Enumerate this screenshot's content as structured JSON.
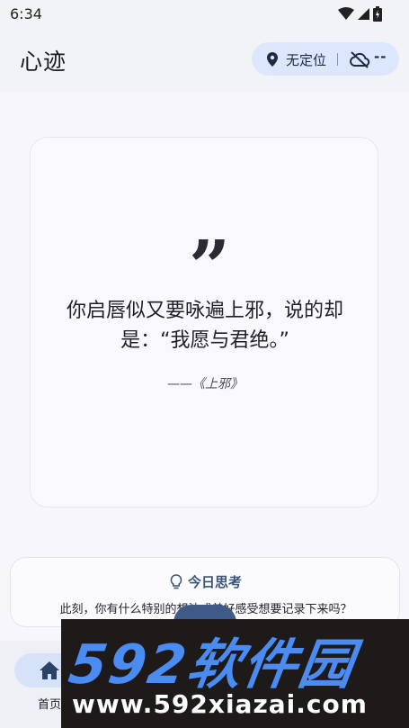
{
  "status_bar": {
    "time": "6:34"
  },
  "app_bar": {
    "title": "心迹",
    "location_label": "无定位",
    "sync_label": "--"
  },
  "quote": {
    "mark": "”",
    "text": "你启唇似又要咏遍上邪，说的却是：“我愿与君绝。”",
    "source": "——《上邪》"
  },
  "daily_thought": {
    "title": "今日思考",
    "prompt": "此刻，你有什么特别的想法或美好感受想要记录下来吗？"
  },
  "bottom_nav": {
    "items": [
      {
        "label": "首页",
        "icon": "home-icon",
        "active": true
      }
    ]
  },
  "watermark": {
    "logo": "592软件园",
    "url": "www.592xiazai.com"
  },
  "colors": {
    "accent": "#3e5a86",
    "pill_bg": "#dde7fb",
    "watermark_blue": "#4a8cf2"
  }
}
